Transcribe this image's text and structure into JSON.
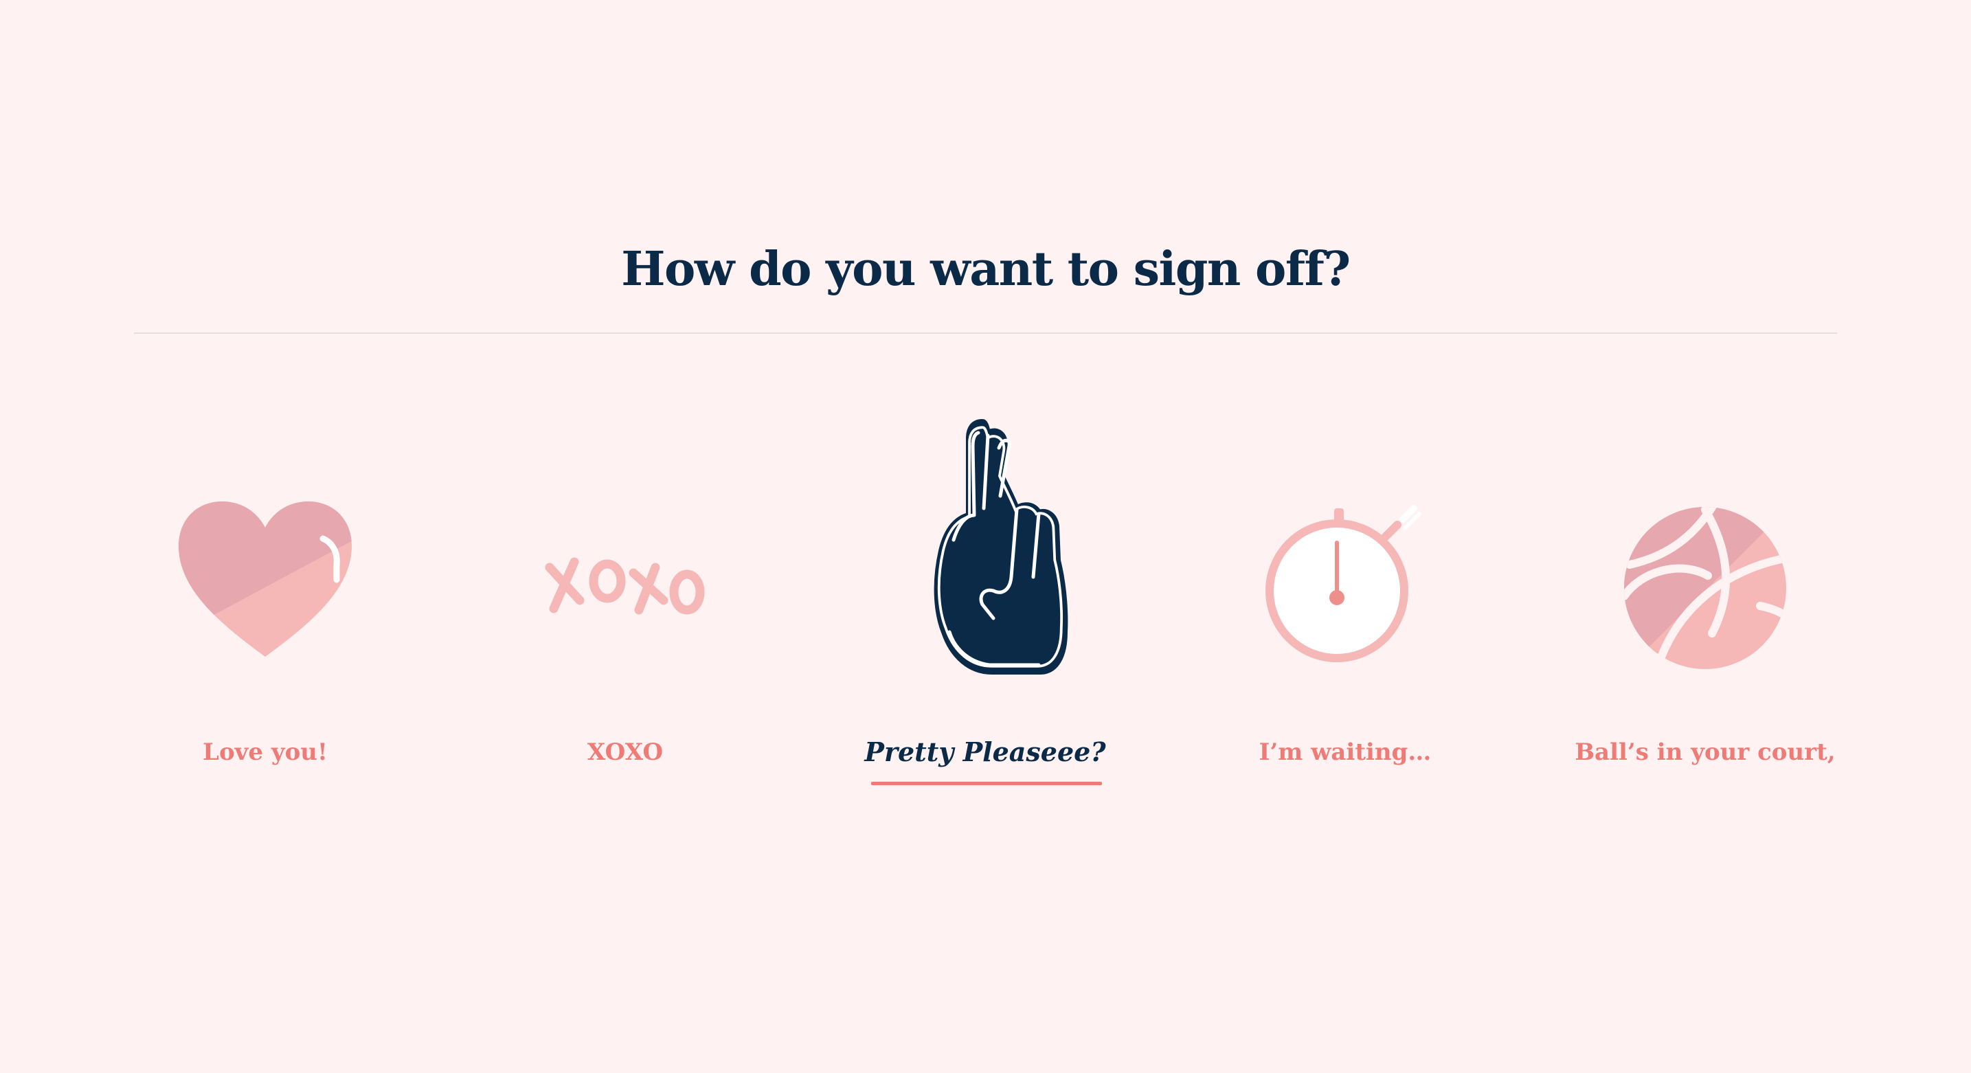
{
  "page": {
    "title": "How do you want to sign off?"
  },
  "options": [
    {
      "label": "Love you!",
      "icon": "heart-icon",
      "selected": false
    },
    {
      "label": "XOXO",
      "icon": "xoxo-icon",
      "selected": false
    },
    {
      "label": "Pretty Pleaseee?",
      "icon": "crossed-fingers-icon",
      "selected": true
    },
    {
      "label": "I’m waiting…",
      "icon": "stopwatch-icon",
      "selected": false
    },
    {
      "label": "Ball’s in your court,",
      "icon": "basketball-icon",
      "selected": false
    }
  ],
  "colors": {
    "background": "#fef2f2",
    "navy": "#0b2a48",
    "coral": "#ee7b76",
    "pink_dark": "#e6a7ae",
    "pink_light": "#f5b8b6",
    "divider": "#e3dfdf"
  }
}
